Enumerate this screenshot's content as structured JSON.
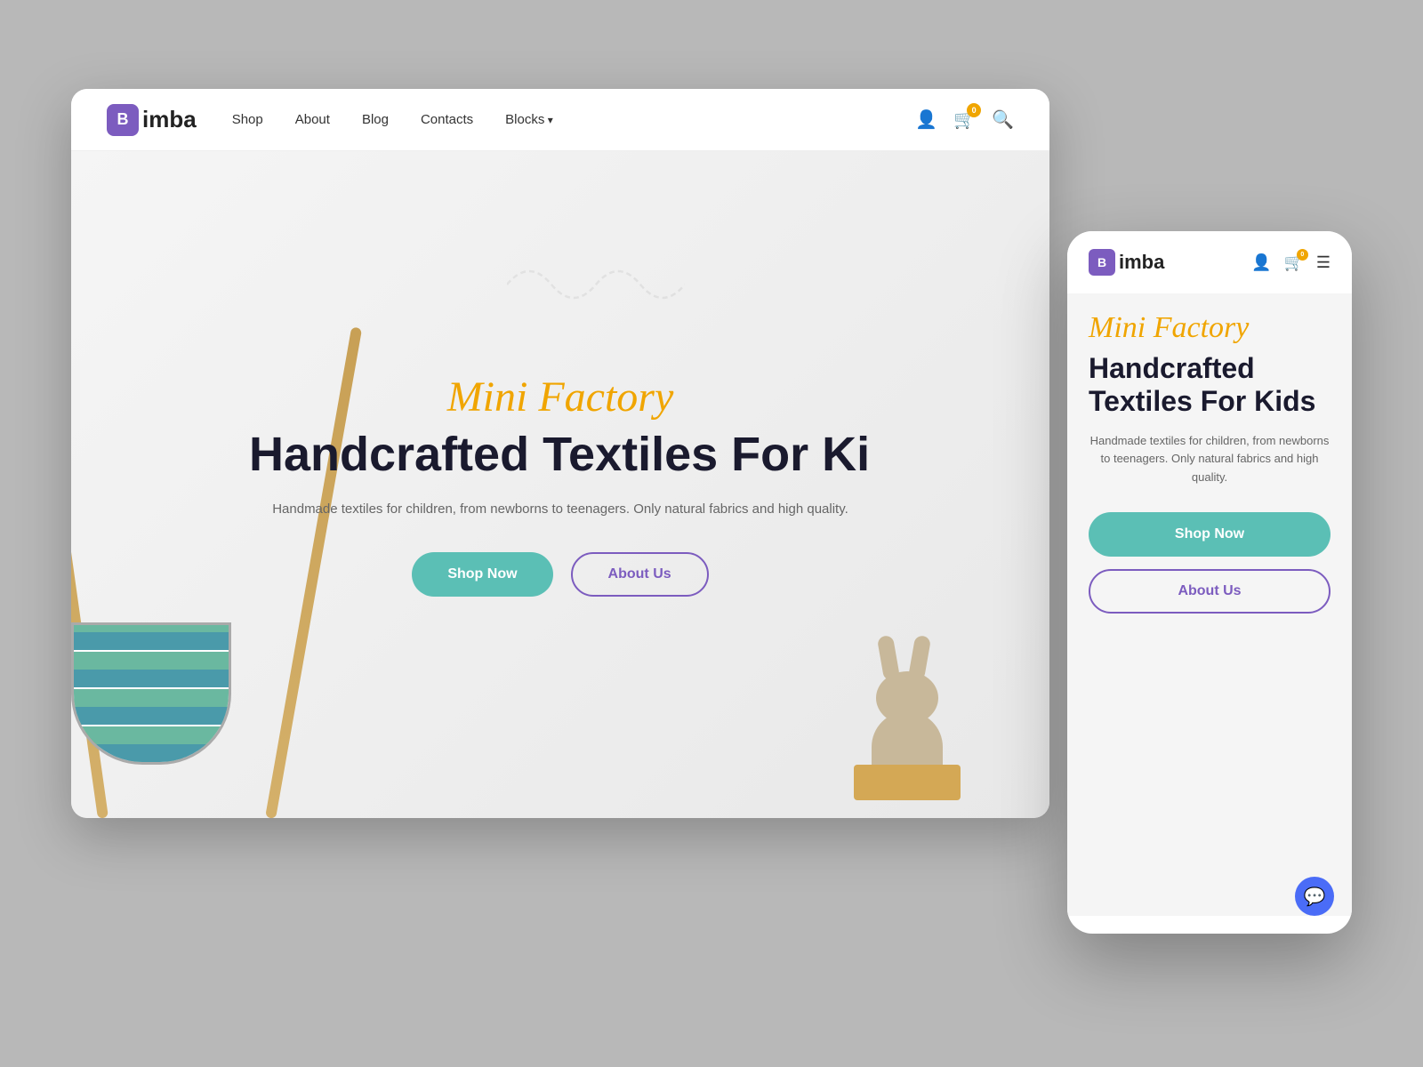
{
  "desktop": {
    "logo": {
      "icon": "B",
      "text": "imba"
    },
    "nav": {
      "links": [
        {
          "label": "Shop",
          "id": "shop"
        },
        {
          "label": "About",
          "id": "about"
        },
        {
          "label": "Blog",
          "id": "blog"
        },
        {
          "label": "Contacts",
          "id": "contacts"
        },
        {
          "label": "Blocks",
          "id": "blocks",
          "hasArrow": true
        }
      ]
    },
    "cart_count": "0",
    "hero": {
      "subtitle": "Mini Factory",
      "title": "Handcrafted Textiles For Kids",
      "description": "Handmade textiles for children, from newborns to teenagers. Only natural fabrics and high quality.",
      "btn_shop": "Shop Now",
      "btn_about": "About Us"
    }
  },
  "mobile": {
    "logo": {
      "icon": "B",
      "text": "imba"
    },
    "cart_count": "0",
    "hero": {
      "subtitle": "Mini Factory",
      "title": "Handcrafted Textiles For Kids",
      "description": "Handmade textiles for children, from newborns to teenagers. Only natural fabrics and high quality.",
      "btn_shop": "Shop Now",
      "btn_about": "About Us"
    }
  }
}
